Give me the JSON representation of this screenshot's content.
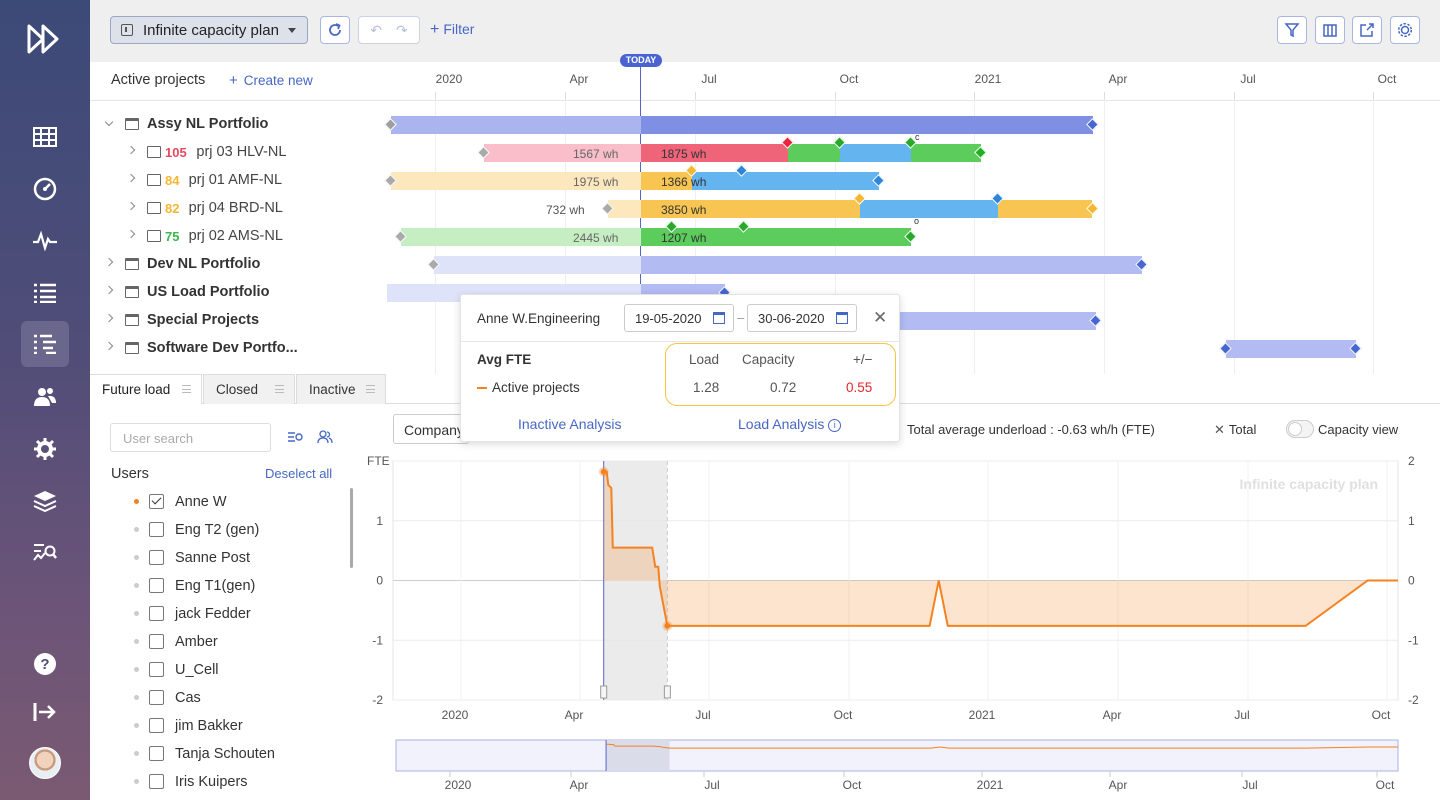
{
  "topbar": {
    "plan_name": "Infinite capacity plan",
    "filter_label": "Filter"
  },
  "timeline": {
    "today_label": "TODAY",
    "ticks": [
      "2020",
      "Apr",
      "Jul",
      "Oct",
      "2021",
      "Apr",
      "Jul",
      "Oct"
    ]
  },
  "projects_header": {
    "title": "Active projects",
    "create_label": "Create new"
  },
  "tree": [
    {
      "label": "Assy NL Portfolio",
      "type": "portfolio",
      "expanded": true
    },
    {
      "priority": "105",
      "label": "prj 03 HLV-NL",
      "priority_color": "#e8485f",
      "type": "project"
    },
    {
      "priority": "84",
      "label": "prj 01 AMF-NL",
      "priority_color": "#f5b731",
      "type": "project"
    },
    {
      "priority": "82",
      "label": "prj 04 BRD-NL",
      "priority_color": "#f5b731",
      "type": "project"
    },
    {
      "priority": "75",
      "label": "prj 02 AMS-NL",
      "priority_color": "#3bb84a",
      "type": "project"
    },
    {
      "label": "Dev NL Portfolio",
      "type": "portfolio"
    },
    {
      "label": "US Load Portfolio",
      "type": "portfolio"
    },
    {
      "label": "Special Projects",
      "type": "portfolio"
    },
    {
      "label": "Software Dev Portfo...",
      "type": "portfolio"
    }
  ],
  "bar_labels": {
    "hlv_past": "1567 wh",
    "hlv_future": "1875 wh",
    "amf_past": "1975 wh",
    "amf_future": "1366 wh",
    "brd_before": "732 wh",
    "brd_future": "3850 wh",
    "ams_past": "2445 wh",
    "ams_future": "1207 wh",
    "mark_c": "c",
    "mark_o": "o"
  },
  "tabs": [
    {
      "label": "Future load"
    },
    {
      "label": "Closed"
    },
    {
      "label": "Inactive"
    }
  ],
  "users_panel": {
    "search_placeholder": "User search",
    "title": "Users",
    "deselect_label": "Deselect all",
    "users": [
      {
        "name": "Anne W",
        "checked": true
      },
      {
        "name": "Eng T2 (gen)",
        "checked": false
      },
      {
        "name": "Sanne Post",
        "checked": false
      },
      {
        "name": "Eng T1(gen)",
        "checked": false
      },
      {
        "name": "jack Fedder",
        "checked": false
      },
      {
        "name": "Amber",
        "checked": false
      },
      {
        "name": "U_Cell",
        "checked": false
      },
      {
        "name": "Cas",
        "checked": false
      },
      {
        "name": "jim Bakker",
        "checked": false
      },
      {
        "name": "Tanja Schouten",
        "checked": false
      },
      {
        "name": "Iris Kuipers",
        "checked": false
      }
    ]
  },
  "chart_controls": {
    "company_select": "Company",
    "summary": "Total average underload : -0.63 wh/h (FTE)",
    "total_label": "Total",
    "capacity_view_label": "Capacity view"
  },
  "popup": {
    "title": "Anne W.Engineering",
    "date_from": "19-05-2020",
    "date_to": "30-06-2020",
    "row_header": "Avg FTE",
    "row_label": "Active projects",
    "col_load": "Load",
    "col_capacity": "Capacity",
    "col_diff": "+/−",
    "load": "1.28",
    "capacity": "0.72",
    "diff": "0.55",
    "inactive_link": "Inactive Analysis",
    "load_link": "Load Analysis"
  },
  "chart_data": {
    "type": "area",
    "ylabel": "FTE",
    "watermark": "Infinite capacity plan",
    "ylim": [
      -2,
      2
    ],
    "y_ticks_left": [
      "1",
      "0",
      "-1",
      "-2"
    ],
    "y_ticks_right": [
      "2",
      "1",
      "0",
      "-1",
      "-2"
    ],
    "x_ticks": [
      "2020",
      "Apr",
      "Jul",
      "Oct",
      "2021",
      "Apr",
      "Jul",
      "Oct"
    ],
    "overview_ticks": [
      "2020",
      "Apr",
      "Jul",
      "Oct",
      "2021",
      "Apr",
      "Jul",
      "Oct"
    ],
    "selection": [
      "2020-05-19",
      "2020-06-30"
    ],
    "today": "2020-05-19",
    "series": [
      {
        "color": "#f58220",
        "points": [
          [
            "2020-05-19",
            1.82
          ],
          [
            "2020-05-21",
            1.82
          ],
          [
            "2020-05-22",
            1.6
          ],
          [
            "2020-05-24",
            1.55
          ],
          [
            "2020-05-25",
            0.55
          ],
          [
            "2020-06-20",
            0.55
          ],
          [
            "2020-06-22",
            0.23
          ],
          [
            "2020-06-24",
            0.23
          ],
          [
            "2020-06-25",
            -0.1
          ],
          [
            "2020-06-30",
            -0.76
          ],
          [
            "2020-12-20",
            -0.76
          ],
          [
            "2020-12-26",
            0.0
          ],
          [
            "2021-01-01",
            -0.76
          ],
          [
            "2021-08-25",
            -0.76
          ],
          [
            "2021-10-05",
            0.0
          ],
          [
            "2021-10-25",
            0.0
          ]
        ]
      }
    ]
  }
}
